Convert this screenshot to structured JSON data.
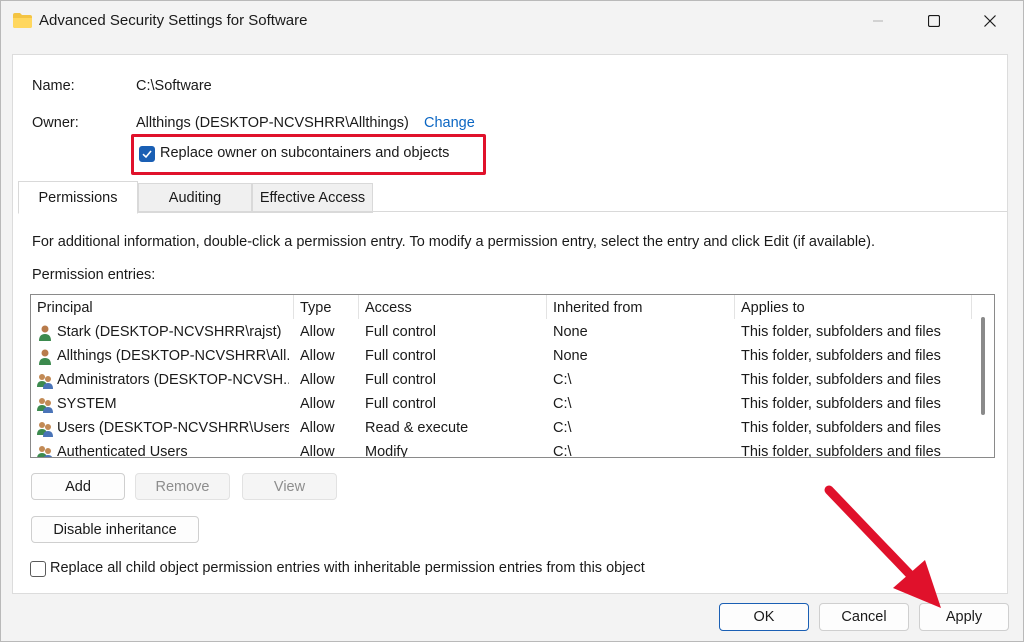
{
  "window": {
    "title": "Advanced Security Settings for Software"
  },
  "info": {
    "name_label": "Name:",
    "name_value": "C:\\Software",
    "owner_label": "Owner:",
    "owner_value": "Allthings (DESKTOP-NCVSHRR\\Allthings)",
    "change_link": "Change",
    "replace_owner_label": "Replace owner on subcontainers and objects",
    "replace_owner_checked": true
  },
  "tabs": [
    {
      "label": "Permissions",
      "active": true
    },
    {
      "label": "Auditing",
      "active": false
    },
    {
      "label": "Effective Access",
      "active": false
    }
  ],
  "permissions": {
    "info_text": "For additional information, double-click a permission entry. To modify a permission entry, select the entry and click Edit (if available).",
    "entries_label": "Permission entries:",
    "columns": [
      "Principal",
      "Type",
      "Access",
      "Inherited from",
      "Applies to"
    ],
    "rows": [
      {
        "icon": "user-icon",
        "principal": "Stark (DESKTOP-NCVSHRR\\rajst)",
        "type": "Allow",
        "access": "Full control",
        "inherited": "None",
        "applies": "This folder, subfolders and files"
      },
      {
        "icon": "user-icon",
        "principal": "Allthings (DESKTOP-NCVSHRR\\All...",
        "type": "Allow",
        "access": "Full control",
        "inherited": "None",
        "applies": "This folder, subfolders and files"
      },
      {
        "icon": "group-icon",
        "principal": "Administrators (DESKTOP-NCVSH...",
        "type": "Allow",
        "access": "Full control",
        "inherited": "C:\\",
        "applies": "This folder, subfolders and files"
      },
      {
        "icon": "group-icon",
        "principal": "SYSTEM",
        "type": "Allow",
        "access": "Full control",
        "inherited": "C:\\",
        "applies": "This folder, subfolders and files"
      },
      {
        "icon": "group-icon",
        "principal": "Users (DESKTOP-NCVSHRR\\Users)",
        "type": "Allow",
        "access": "Read & execute",
        "inherited": "C:\\",
        "applies": "This folder, subfolders and files"
      },
      {
        "icon": "group-icon",
        "principal": "Authenticated Users",
        "type": "Allow",
        "access": "Modify",
        "inherited": "C:\\",
        "applies": "This folder, subfolders and files"
      }
    ],
    "add_button": "Add",
    "remove_button": "Remove",
    "view_button": "View",
    "disable_inheritance_button": "Disable inheritance",
    "replace_child_label": "Replace all child object permission entries with inheritable permission entries from this object",
    "replace_child_checked": false
  },
  "footer": {
    "ok": "OK",
    "cancel": "Cancel",
    "apply": "Apply"
  },
  "colors": {
    "accent": "#1a5fb4",
    "link": "#0b66c3",
    "annotation_red": "#e0112b"
  }
}
